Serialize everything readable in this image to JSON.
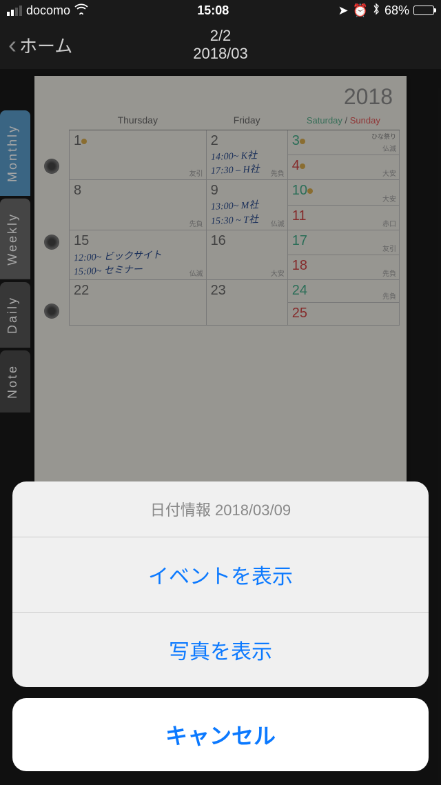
{
  "status": {
    "carrier": "docomo",
    "time": "15:08",
    "battery_pct": "68%"
  },
  "nav": {
    "back_label": "ホーム",
    "page_index": "2/2",
    "date_label": "2018/03"
  },
  "tabs": {
    "monthly": "Monthly",
    "weekly": "Weekly",
    "daily": "Daily",
    "note": "Note"
  },
  "calendar": {
    "year": "2018",
    "headers": {
      "thursday": "Thursday",
      "friday": "Friday",
      "saturday": "Saturday",
      "sunday": "Sunday"
    },
    "cells": {
      "d1": "1",
      "d2": "2",
      "d3": "3",
      "d4": "4",
      "d8": "8",
      "d9": "9",
      "d10": "10",
      "d11": "11",
      "d15": "15",
      "d16": "16",
      "d17": "17",
      "d18": "18",
      "d22": "22",
      "d23": "23",
      "d24": "24",
      "d25": "25"
    },
    "notes": {
      "d2a": "14:00~ K社",
      "d2b": "17:30 – H社",
      "d9a": "13:00~ M社",
      "d9b": "15:30 ~ T社",
      "d15a": "12:00~ ビックサイト",
      "d15b": "15:00~ セミナー"
    },
    "rokuyo": {
      "r1": "友引",
      "r2": "先負",
      "r3": "仏滅",
      "r4": "大安",
      "r8": "先負",
      "r9": "仏滅",
      "r10": "大安",
      "r11": "赤口",
      "r15": "仏滅",
      "r16": "大安",
      "r17": "友引",
      "r18": "先負",
      "r24": "先負"
    },
    "holiday": {
      "d3": "ひな祭り"
    }
  },
  "sheet": {
    "title": "日付情報 2018/03/09",
    "show_events": "イベントを表示",
    "show_photos": "写真を表示",
    "cancel": "キャンセル"
  }
}
